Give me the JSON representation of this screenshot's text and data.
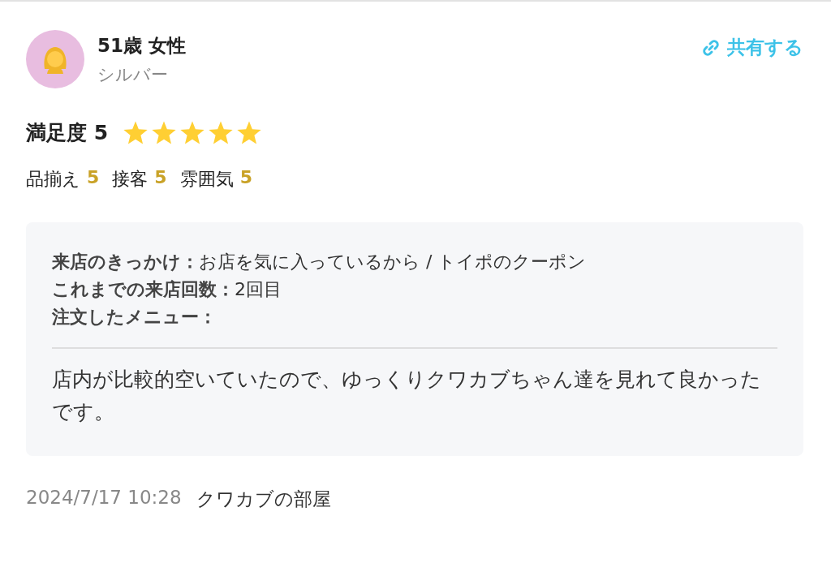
{
  "reviewer": {
    "name": "51歳 女性",
    "rank": "シルバー"
  },
  "share": {
    "label": "共有する"
  },
  "satisfaction": {
    "label": "満足度 5",
    "stars": 5
  },
  "sub_ratings": [
    {
      "label": "品揃え",
      "value": "5"
    },
    {
      "label": "接客",
      "value": "5"
    },
    {
      "label": "雰囲気",
      "value": "5"
    }
  ],
  "details": [
    {
      "label": "来店のきっかけ：",
      "value": "お店を気に入っているから / トイポのクーポン"
    },
    {
      "label": "これまでの来店回数：",
      "value": "2回目"
    },
    {
      "label": "注文したメニュー："
    }
  ],
  "comment": "店内が比較的空いていたので、ゆっくりクワカブちゃん達を見れて良かったです。",
  "footer": {
    "date": "2024/7/17 10:28",
    "shop": "クワカブの部屋"
  }
}
